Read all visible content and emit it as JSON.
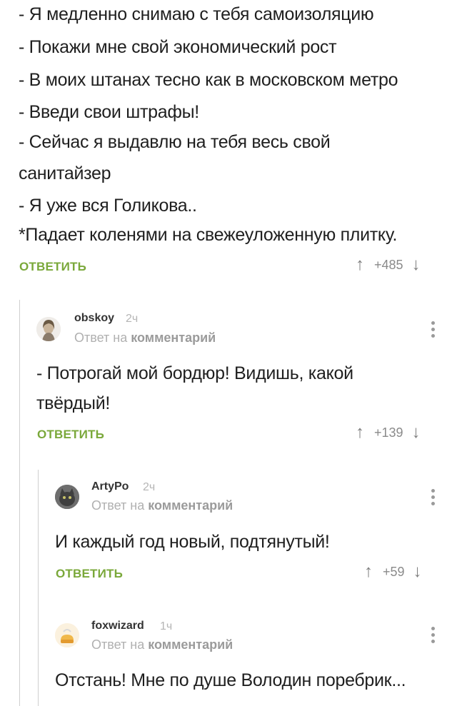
{
  "top": {
    "lines": [
      "- Я медленно снимаю с тебя самоизоляцию",
      "- Покажи мне свой экономический рост",
      "- В моих штанах тесно как в московском метро",
      "- Введи свои штрафы!",
      "- Сейчас я выдавлю на тебя весь свой",
      "санитайзер",
      "- Я уже вся Голикова..",
      "*Падает коленями на свежеуложенную плитку."
    ],
    "reply": "ОТВЕТИТЬ",
    "rating": "+485"
  },
  "comments": [
    {
      "user": "obskoy",
      "time": "2ч",
      "sub_prefix": "Ответ на",
      "sub_link": "комментарий",
      "text_lines": [
        "- Потрогай мой бордюр! Видишь, какой",
        "твёрдый!"
      ],
      "reply": "ОТВЕТИТЬ",
      "rating": "+139"
    },
    {
      "user": "ArtyPo",
      "time": "2ч",
      "sub_prefix": "Ответ на",
      "sub_link": "комментарий",
      "text_lines": [
        "И каждый год новый, подтянутый!"
      ],
      "reply": "ОТВЕТИТЬ",
      "rating": "+59"
    },
    {
      "user": "foxwizard",
      "time": "1ч",
      "sub_prefix": "Ответ на",
      "sub_link": "комментарий",
      "text_lines": [
        "Отстань! Мне по душе Володин поребрик..."
      ]
    }
  ],
  "icons": {
    "up": "arrow-up-icon",
    "down": "arrow-down-icon",
    "menu": "kebab-menu-icon"
  },
  "colors": {
    "accent": "#7aa83a",
    "muted": "#b0b0b0"
  }
}
